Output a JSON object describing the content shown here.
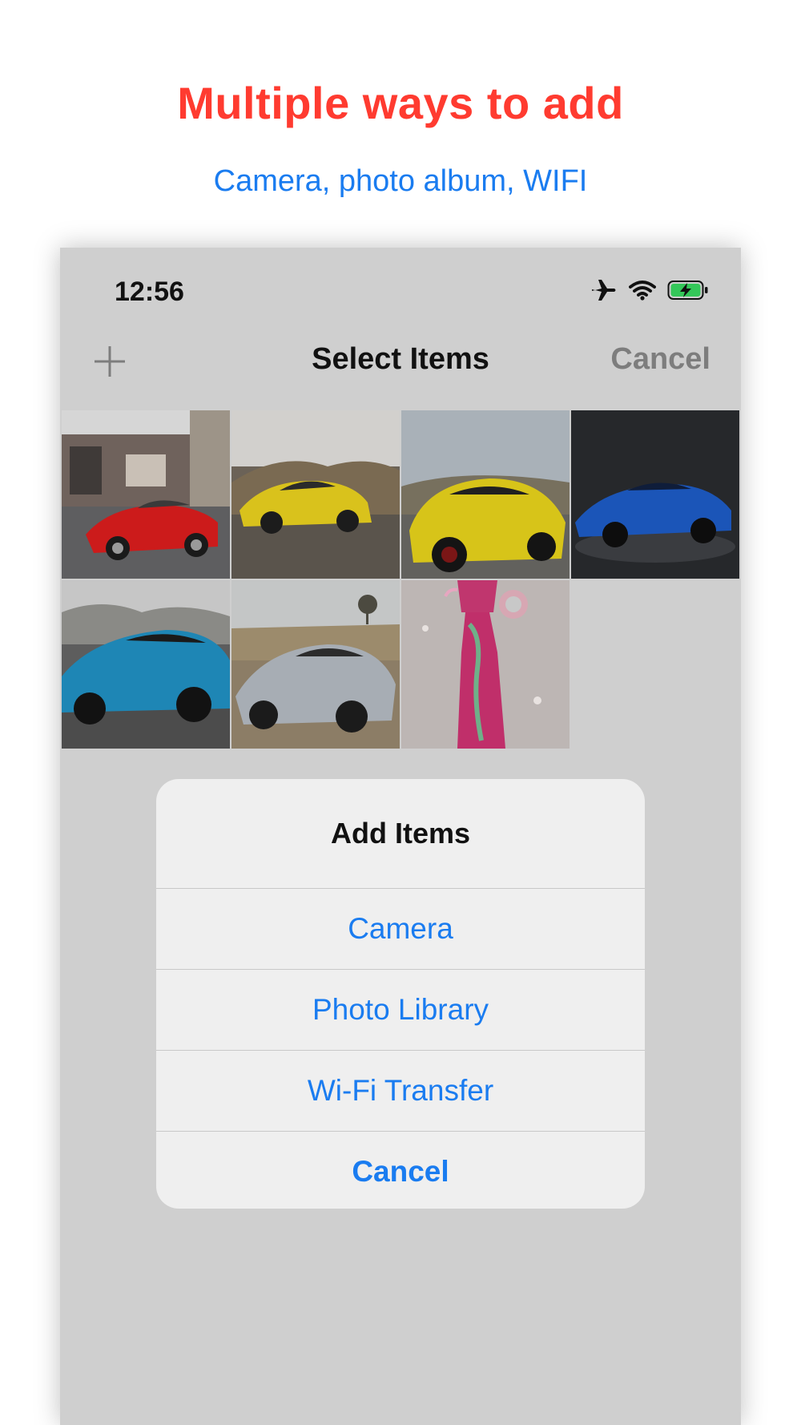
{
  "promo": {
    "headline": "Multiple ways to add",
    "subheadline": "Camera, photo album, WIFI"
  },
  "status_bar": {
    "time": "12:56",
    "icons": [
      "airplane-icon",
      "wifi-icon",
      "battery-charging-icon"
    ]
  },
  "nav": {
    "add_icon": "plus-icon",
    "title": "Select Items",
    "cancel_label": "Cancel"
  },
  "gallery": {
    "items": [
      {
        "subject": "red car"
      },
      {
        "subject": "yellow car"
      },
      {
        "subject": "yellow car"
      },
      {
        "subject": "blue car"
      },
      {
        "subject": "blue car"
      },
      {
        "subject": "silver car"
      },
      {
        "subject": "pink dress"
      }
    ]
  },
  "action_sheet": {
    "title": "Add Items",
    "options": [
      {
        "label": "Camera"
      },
      {
        "label": "Photo Library"
      },
      {
        "label": "Wi-Fi Transfer"
      }
    ],
    "cancel_label": "Cancel"
  },
  "colors": {
    "headline": "#ff3b30",
    "accent": "#1a7cf0",
    "overlay_bg": "#cfcfcf",
    "sheet_bg": "#efefef"
  }
}
